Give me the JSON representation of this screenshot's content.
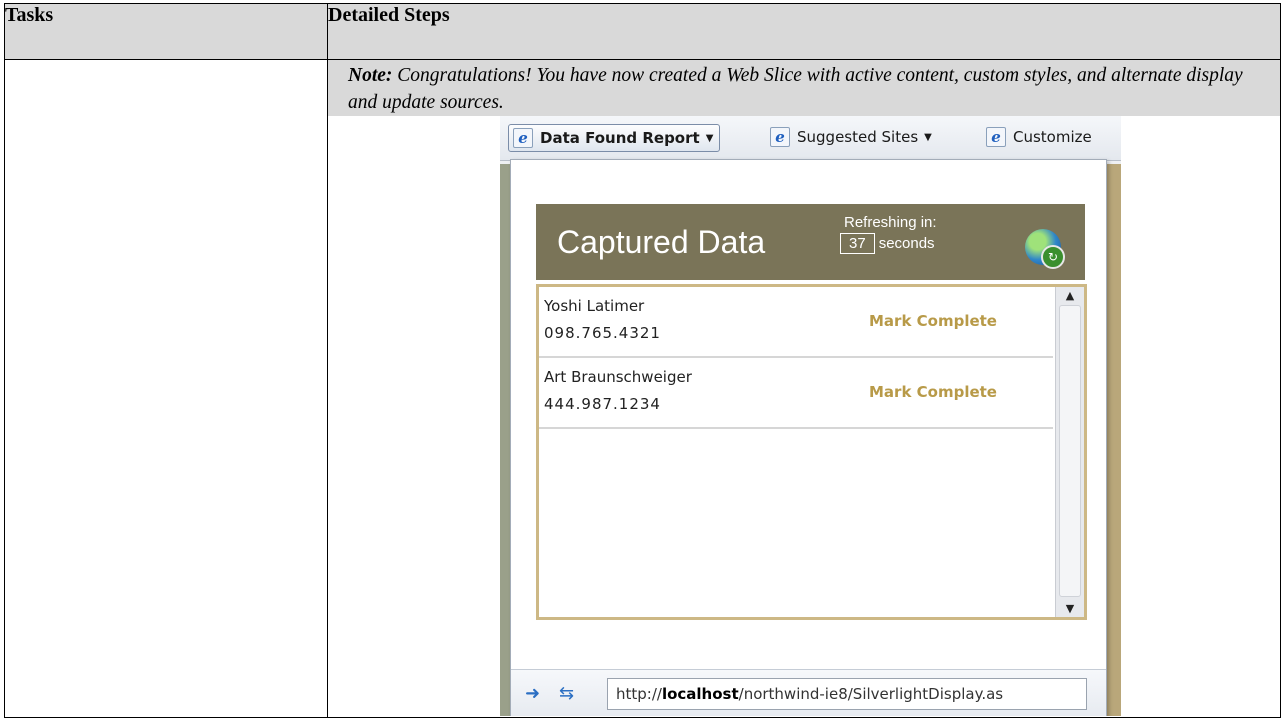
{
  "table": {
    "col1_header": "Tasks",
    "col2_header": "Detailed Steps"
  },
  "note": {
    "label": "Note:",
    "text": " Congratulations! You have now created a Web Slice with active content, custom styles, and alternate display and update sources."
  },
  "screenshot": {
    "favorites": [
      {
        "label": "Data Found Report",
        "icon": "ie-icon",
        "active": true
      },
      {
        "label": "Suggested Sites",
        "icon": "ie-icon",
        "active": false
      },
      {
        "label": "Customize",
        "icon": "ie-icon",
        "active": false
      }
    ],
    "panel": {
      "title": "Captured Data",
      "refresh_label": "Refreshing in:",
      "seconds_value": "37",
      "seconds_label": "seconds",
      "icon": "globe-refresh-icon"
    },
    "rows": [
      {
        "name": "Yoshi Latimer",
        "phone": "098.765.4321",
        "action": "Mark Complete"
      },
      {
        "name": "Art Braunschweiger",
        "phone": "444.987.1234",
        "action": "Mark Complete"
      }
    ],
    "status": {
      "url_prefix": "http://",
      "url_host": "localhost",
      "url_path": "/northwind-ie8/SilverlightDisplay.as"
    },
    "colors": {
      "panel_header": "#7a7458",
      "list_border": "#cdb885",
      "action_text": "#b89a48"
    }
  }
}
